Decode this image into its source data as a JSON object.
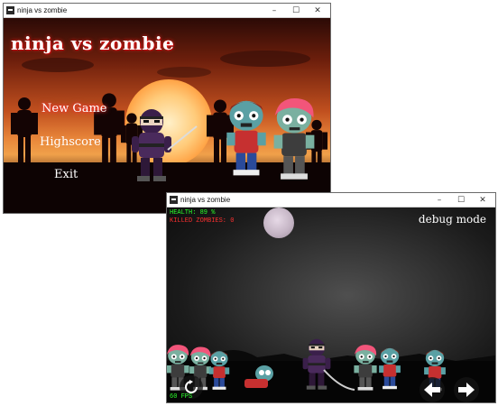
{
  "menu_window": {
    "title": "ninja vs zombie",
    "game_title": "ninja vs zombie",
    "menu_items": [
      "New Game",
      "Highscore",
      "Exit"
    ],
    "selected_item": "New Game"
  },
  "game_window": {
    "title": "ninja vs zombie",
    "hud": {
      "health": "HEALTH: 89 %",
      "killed": "KILLED ZOMBIES: 0",
      "fps": "60 FPS"
    },
    "debug_label": "debug mode",
    "controls": [
      "restart-icon",
      "arrow-left-icon",
      "arrow-right-icon"
    ]
  },
  "window_buttons": [
    "minimize",
    "maximize",
    "close"
  ],
  "colors": {
    "health": "#2bff2b",
    "killed": "#ff3030",
    "fps": "#2bff2b",
    "title_glow": "#ff2020"
  }
}
